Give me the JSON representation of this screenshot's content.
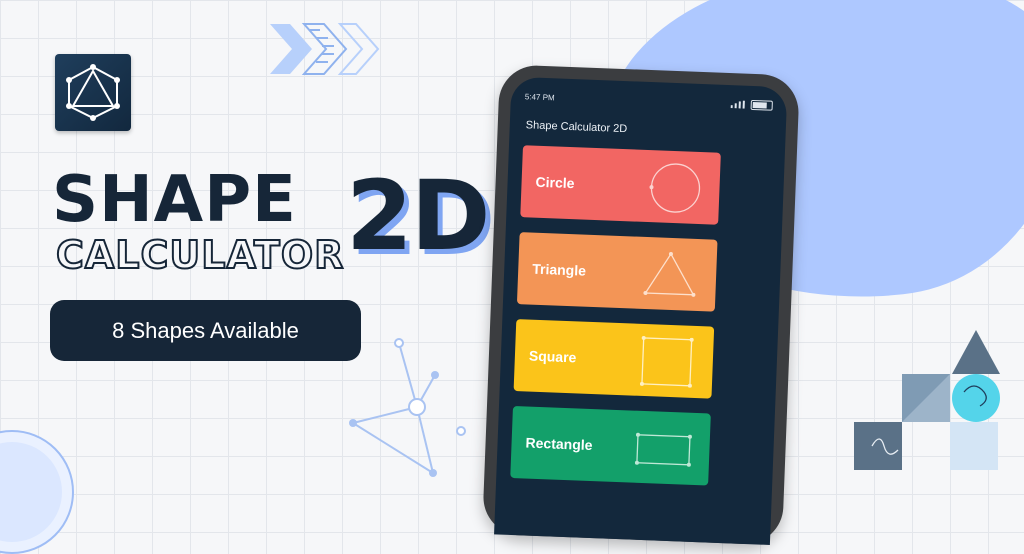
{
  "brand": {
    "title_line1": "SHAPE",
    "title_line2": "CALCULATOR",
    "title_badge": "2D",
    "tagline": "8 Shapes Available"
  },
  "phone": {
    "status_time": "5:47 PM",
    "status_battery": "",
    "app_title": "Shape Calculator 2D",
    "cards": [
      {
        "label": "Circle",
        "color": "#f26663",
        "icon": "circle-outline-icon"
      },
      {
        "label": "Triangle",
        "color": "#f39556",
        "icon": "triangle-outline-icon"
      },
      {
        "label": "Square",
        "color": "#fbc41a",
        "icon": "square-outline-icon"
      },
      {
        "label": "Rectangle",
        "color": "#13a06a",
        "icon": "rectangle-outline-icon"
      }
    ]
  },
  "colors": {
    "navy": "#162638",
    "accent_blue": "#aec8ff",
    "badge_shadow": "#7fa5f2"
  },
  "icons": [
    "geometry-logo-icon",
    "chevron-arrows-icon",
    "node-graph-icon",
    "geometric-blocks-icon"
  ]
}
